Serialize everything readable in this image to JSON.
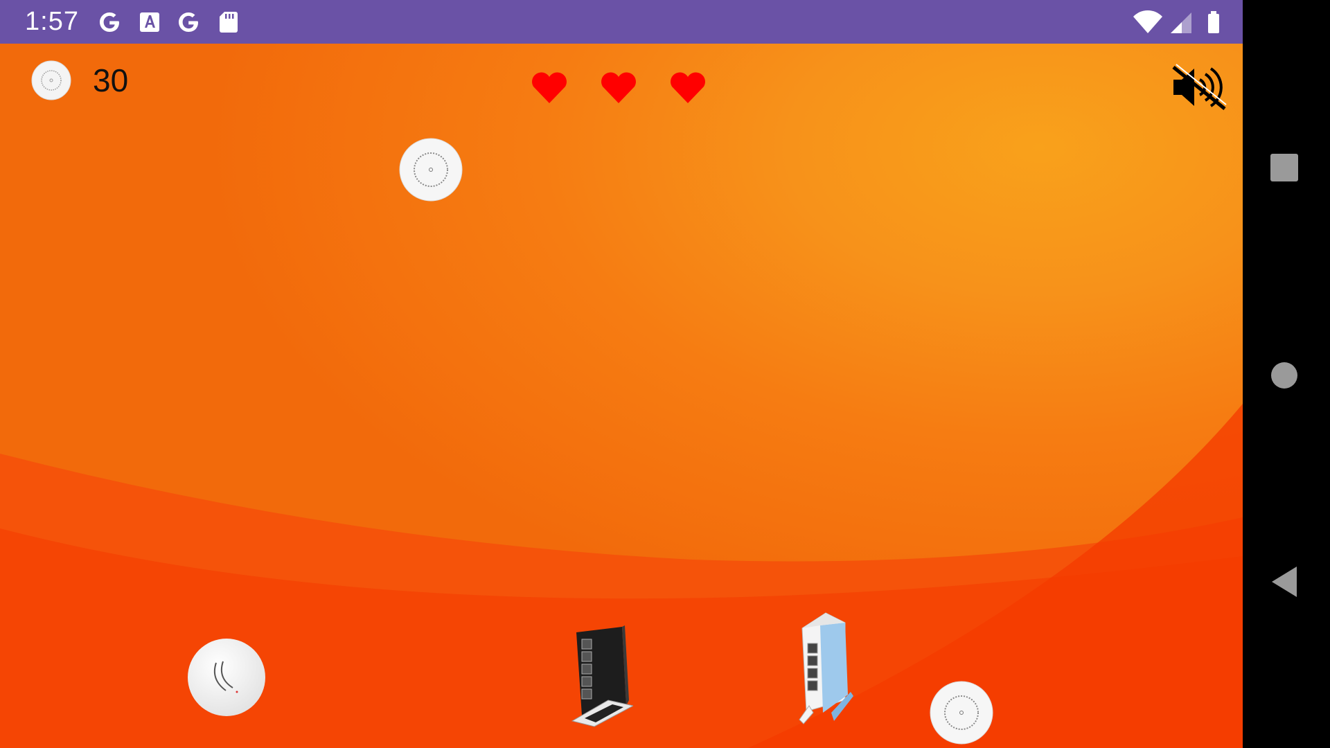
{
  "status_bar": {
    "time": "1:57",
    "left_icons": [
      "google-g-icon",
      "text-a-icon",
      "google-g-icon",
      "sd-card-icon"
    ],
    "right_icons": [
      "wifi-icon",
      "cell-signal-icon",
      "battery-icon"
    ],
    "background": "#6a52a6"
  },
  "hud": {
    "score": "30",
    "lives": 3,
    "heart_color": "#ff0000",
    "sound_state": "muted"
  },
  "game_objects": {
    "falling": [
      "ceiling-ap-disc"
    ],
    "ground": [
      "ceiling-ap-disc-large",
      "black-router",
      "blue-white-router",
      "ceiling-ap-disc"
    ]
  },
  "colors": {
    "bg_light": "#f9a11b",
    "bg_mid": "#f67c12",
    "bg_dark": "#f43a00"
  },
  "navigation_bar": [
    "recents-square-icon",
    "home-circle-icon",
    "back-triangle-icon"
  ]
}
